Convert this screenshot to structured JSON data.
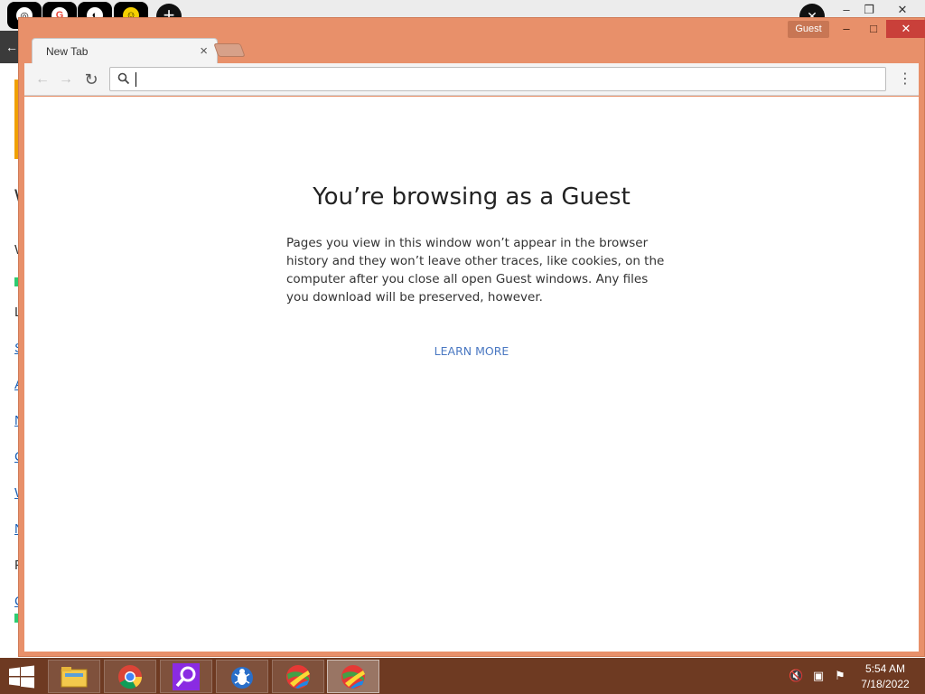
{
  "background_window": {
    "letters": [
      "W",
      "W",
      "L",
      "S",
      "A",
      "N",
      "C",
      "W",
      "N",
      "F",
      "C"
    ],
    "back_arrow": "←"
  },
  "window": {
    "profile_label": "Guest",
    "min_glyph": "–",
    "max_glyph": "□",
    "close_glyph": "✕"
  },
  "tab": {
    "title": "New Tab",
    "close_glyph": "×"
  },
  "toolbar": {
    "back_glyph": "←",
    "forward_glyph": "→",
    "reload_glyph": "↻",
    "omnibox_value": "",
    "menu_glyph": "⋮"
  },
  "page": {
    "heading": "You’re browsing as a Guest",
    "body": "Pages you view in this window won’t appear in the browser history and they won’t leave other traces, like cookies, on the computer after you close all open Guest windows. Any files you download will be preserved, however.",
    "learn_more": "LEARN MORE"
  },
  "taskbar": {
    "items": [
      {
        "name": "file-explorer",
        "icon": "folder-icon"
      },
      {
        "name": "chrome",
        "icon": "chrome-icon"
      },
      {
        "name": "search-app",
        "icon": "magnifier-icon"
      },
      {
        "name": "bug-app",
        "icon": "bug-icon"
      },
      {
        "name": "colorful-app-1",
        "icon": "colorful-ball-icon"
      },
      {
        "name": "colorful-app-2",
        "icon": "colorful-ball-icon"
      }
    ],
    "time": "5:54 AM",
    "date": "7/18/2022"
  },
  "colors": {
    "window_frame": "#e8906a",
    "close_button": "#c9403a",
    "taskbar": "#6e3a22",
    "link": "#4a78c2"
  }
}
